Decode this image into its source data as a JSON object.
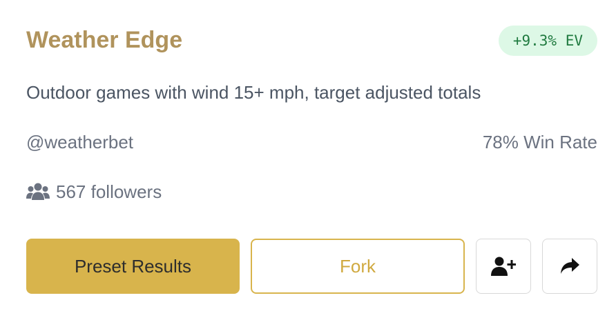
{
  "card": {
    "title": "Weather Edge",
    "ev_badge": "+9.3% EV",
    "description": "Outdoor games with wind 15+ mph, target adjusted totals",
    "author": "@weatherbet",
    "win_rate": "78% Win Rate",
    "followers": "567 followers"
  },
  "actions": {
    "preset_label": "Preset Results",
    "fork_label": "Fork",
    "follow_icon": "user-plus-icon",
    "share_icon": "share-icon"
  },
  "icons": {
    "followers_icon": "users-icon"
  },
  "colors": {
    "title": "#b0935c",
    "accent": "#d8b44c",
    "ev_badge_bg": "#ddf8e6",
    "ev_badge_text": "#1f7a3f"
  }
}
